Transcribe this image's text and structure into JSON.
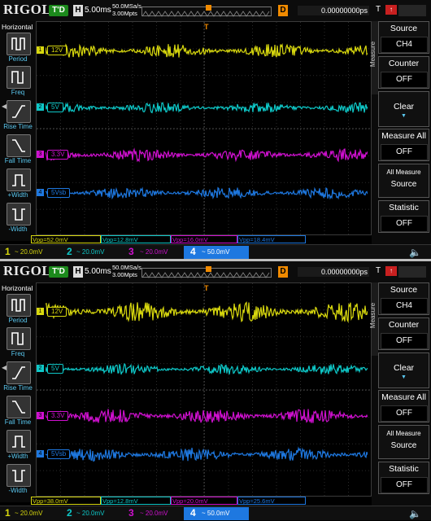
{
  "brand": "RIGOL",
  "screens": [
    {
      "trigger_status": "T'D",
      "h_label": "H",
      "timebase": "5.00ms",
      "sample_rate": "50.0MSa/s",
      "mem_depth": "3.00Mpts",
      "d_label": "D",
      "delay": "0.00000000ps",
      "t_label": "T",
      "left_panel": {
        "title": "Horizontal",
        "buttons": [
          "Period",
          "Freq",
          "Rise Time",
          "Fall Time",
          "+Width",
          "-Width"
        ]
      },
      "channels": [
        {
          "num": "1",
          "tag": "12V",
          "color": "#d8d80e",
          "scale": "20.0mV",
          "noise": 0.55
        },
        {
          "num": "2",
          "tag": "5V",
          "color": "#0ec8c8",
          "scale": "20.0mV",
          "noise": 0.35
        },
        {
          "num": "3",
          "tag": "3.3V",
          "color": "#d010d0",
          "scale": "20.0mV",
          "noise": 0.45
        },
        {
          "num": "4",
          "tag": "5Vsb",
          "color": "#1e78e0",
          "scale": "50.0mV",
          "noise": 0.4
        }
      ],
      "measurements": [
        "Vpp=52.0mV",
        "Vpp=12.8mV",
        "Vpp=16.0mV",
        "Vpp=18.4mV"
      ],
      "menu": {
        "tab": "Measure",
        "source_label": "Source",
        "source_value": "CH4",
        "counter_label": "Counter",
        "counter_value": "OFF",
        "clear_label": "Clear",
        "measure_all_label": "Measure All",
        "measure_all_value": "OFF",
        "all_measure_label": "All Measure",
        "all_measure_value": "Source",
        "statistic_label": "Statistic",
        "statistic_value": "OFF"
      }
    },
    {
      "trigger_status": "T'D",
      "h_label": "H",
      "timebase": "5.00ms",
      "sample_rate": "50.0MSa/s",
      "mem_depth": "3.00Mpts",
      "d_label": "D",
      "delay": "0.00000000ps",
      "t_label": "T",
      "left_panel": {
        "title": "Horizontal",
        "buttons": [
          "Period",
          "Freq",
          "Rise Time",
          "Fall Time",
          "+Width",
          "-Width"
        ]
      },
      "channels": [
        {
          "num": "1",
          "tag": "12V",
          "color": "#d8d80e",
          "scale": "20.0mV",
          "noise": 0.9
        },
        {
          "num": "2",
          "tag": "5V",
          "color": "#0ec8c8",
          "scale": "20.0mV",
          "noise": 0.35
        },
        {
          "num": "3",
          "tag": "3.3V",
          "color": "#d010d0",
          "scale": "20.0mV",
          "noise": 0.6
        },
        {
          "num": "4",
          "tag": "5Vsb",
          "color": "#1e78e0",
          "scale": "50.0mV",
          "noise": 0.55
        }
      ],
      "measurements": [
        "Vpp=38.0mV",
        "Vpp=12.8mV",
        "Vpp=20.0mV",
        "Vpp=25.6mV"
      ],
      "menu": {
        "tab": "Measure",
        "source_label": "Source",
        "source_value": "CH4",
        "counter_label": "Counter",
        "counter_value": "OFF",
        "clear_label": "Clear",
        "measure_all_label": "Measure All",
        "measure_all_value": "OFF",
        "all_measure_label": "All Measure",
        "all_measure_value": "Source",
        "statistic_label": "Statistic",
        "statistic_value": "OFF"
      }
    }
  ]
}
